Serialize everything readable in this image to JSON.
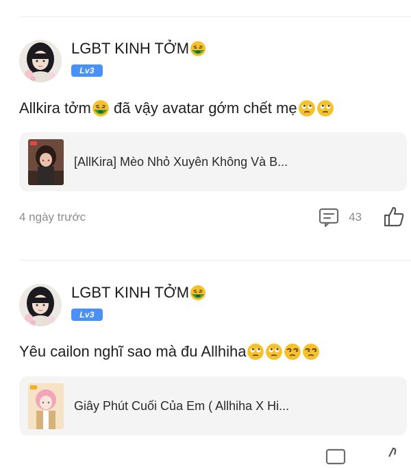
{
  "posts": [
    {
      "author": "LGBT KINH TỞM",
      "author_emoji": "nauseated-face",
      "level": "Lv3",
      "text": "Allkira tởm",
      "text_after_emoji": " đã vậy avatar gớm chết mẹ",
      "trailing_emojis": [
        "eye-roll-face",
        "eye-roll-face"
      ],
      "book_title": "[AllKira] Mèo Nhỏ Xuyên Không Và B...",
      "time": "4 ngày trước",
      "comment_count": "43"
    },
    {
      "author": "LGBT KINH TỞM",
      "author_emoji": "nauseated-face",
      "level": "Lv3",
      "text": "Yêu cailon nghĩ sao mà đu Allhiha",
      "trailing_emojis": [
        "eye-roll-face",
        "eye-roll-face",
        "unamused-face",
        "unamused-face"
      ],
      "book_title": "Giây Phút Cuối Của Em ( Allhiha X Hi..."
    }
  ],
  "colors": {
    "level_badge": "#4a90f5",
    "card_bg": "#f4f4f4",
    "meta_text": "#8c8c8c",
    "emoji_yellow": "#f6c12b",
    "emoji_green": "#2f8b3a"
  }
}
